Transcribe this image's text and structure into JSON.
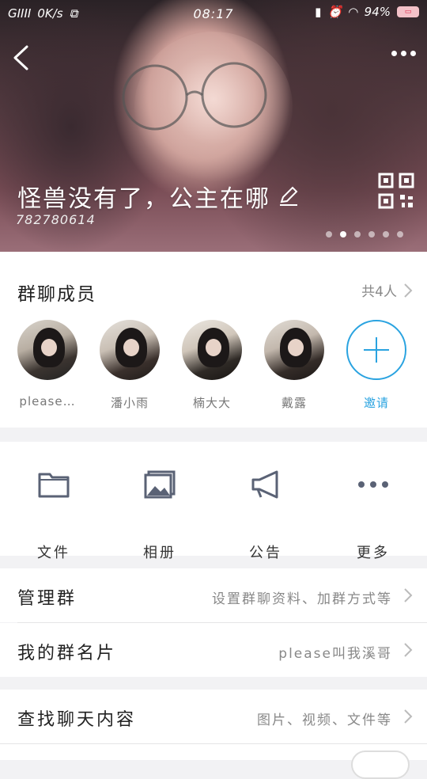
{
  "status_bar": {
    "signal": "GIIII",
    "speed": "0K/s",
    "time": "08:17",
    "battery": "94%"
  },
  "hero": {
    "group_name": "怪兽没有了，公主在哪",
    "group_id": "782780614",
    "carousel_count": 6,
    "carousel_active_index": 1
  },
  "members_section": {
    "title": "群聊成员",
    "count_label": "共4人",
    "members": [
      {
        "name": "please…"
      },
      {
        "name": "潘小雨"
      },
      {
        "name": "楠大大"
      },
      {
        "name": "戴露"
      }
    ],
    "invite_label": "邀请"
  },
  "tools": [
    {
      "label": "文件",
      "icon": "folder-icon"
    },
    {
      "label": "相册",
      "icon": "album-icon"
    },
    {
      "label": "公告",
      "icon": "megaphone-icon"
    },
    {
      "label": "更多",
      "icon": "more-dots-icon"
    }
  ],
  "settings": {
    "manage_group": {
      "title": "管理群",
      "value": "设置群聊资料、加群方式等"
    },
    "my_card": {
      "title": "我的群名片",
      "value": "please叫我溪哥"
    },
    "search_chat": {
      "title": "查找聊天内容",
      "value": "图片、视频、文件等"
    }
  },
  "colors": {
    "accent": "#2aa3e0"
  }
}
